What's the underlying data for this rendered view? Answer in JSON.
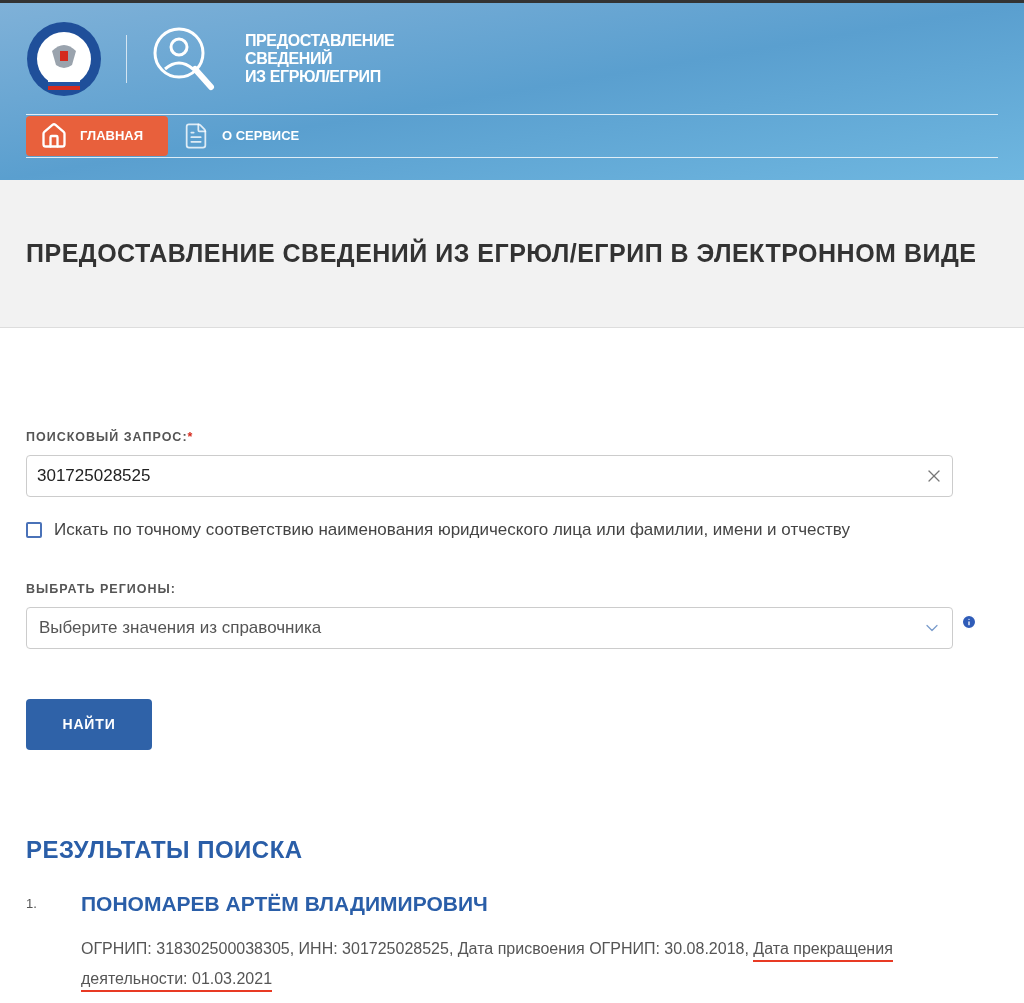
{
  "header": {
    "service_title_lines": [
      "ПРЕДОСТАВЛЕНИЕ",
      "СВЕДЕНИЙ",
      "ИЗ ЕГРЮЛ/ЕГРИП"
    ]
  },
  "nav": [
    {
      "label": "ГЛАВНАЯ",
      "kind": "home",
      "selected": true
    },
    {
      "label": "О СЕРВИСЕ",
      "kind": "document",
      "selected": false
    }
  ],
  "page_title": "ПРЕДОСТАВЛЕНИЕ СВЕДЕНИЙ ИЗ ЕГРЮЛ/ЕГРИП В ЭЛЕКТРОННОМ ВИДЕ",
  "search": {
    "label": "ПОИСКОВЫЙ ЗАПРОС:",
    "required_mark": "*",
    "value": "301725028525"
  },
  "exact_match": {
    "label": "Искать по точному соответствию наименования юридического лица или фамилии, имени и отчеству",
    "checked": false
  },
  "regions": {
    "label": "ВЫБРАТЬ РЕГИОНЫ:",
    "placeholder": "Выберите значения из справочника"
  },
  "submit": "НАЙТИ",
  "results": {
    "title": "РЕЗУЛЬТАТЫ ПОИСКА",
    "items": [
      {
        "number": "1.",
        "name": "ПОНОМАРЕВ АРТЁМ ВЛАДИМИРОВИЧ",
        "details": [
          {
            "text": "ОГРНИП: 318302500038305, ИНН: 301725028525, Дата присвоения ОГРНИП: 30.08.2018, ",
            "underlined": false
          },
          {
            "text": "Дата прекращения деятельности: 01.03.2021",
            "underlined": true
          }
        ]
      }
    ]
  }
}
